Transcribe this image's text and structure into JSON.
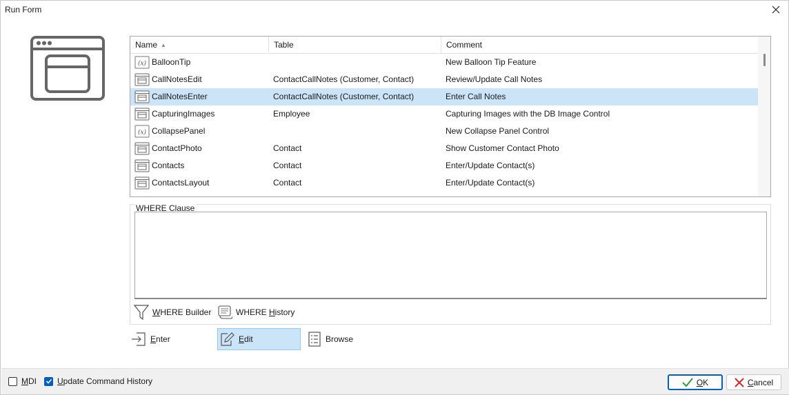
{
  "window": {
    "title": "Run Form"
  },
  "grid": {
    "columns": [
      {
        "label": "Name"
      },
      {
        "label": "Table"
      },
      {
        "label": "Comment"
      }
    ],
    "rows": [
      {
        "icon": "variable-icon",
        "name": "BalloonTip",
        "table": "",
        "comment": "New Balloon Tip Feature"
      },
      {
        "icon": "form-icon",
        "name": "CallNotesEdit",
        "table": "ContactCallNotes (Customer, Contact)",
        "comment": "Review/Update Call Notes"
      },
      {
        "icon": "form-icon",
        "name": "CallNotesEnter",
        "table": "ContactCallNotes (Customer, Contact)",
        "comment": "Enter Call Notes"
      },
      {
        "icon": "form-icon",
        "name": "CapturingImages",
        "table": "Employee",
        "comment": "Capturing Images with the DB Image Control"
      },
      {
        "icon": "variable-icon",
        "name": "CollapsePanel",
        "table": "",
        "comment": "New Collapse Panel Control"
      },
      {
        "icon": "form-icon",
        "name": "ContactPhoto",
        "table": "Contact",
        "comment": "Show Customer Contact Photo"
      },
      {
        "icon": "form-icon",
        "name": "Contacts",
        "table": "Contact",
        "comment": "Enter/Update Contact(s)"
      },
      {
        "icon": "form-icon",
        "name": "ContactsLayout",
        "table": "Contact",
        "comment": "Enter/Update Contact(s)"
      }
    ],
    "selected_row": 2
  },
  "where": {
    "legend": "WHERE Clause",
    "value": "",
    "builder_first": "W",
    "builder_rest": "HERE Builder",
    "history_pre": "WHERE ",
    "history_first": "H",
    "history_rest": "istory"
  },
  "actions": {
    "enter_first": "E",
    "enter_rest": "nter",
    "edit_first": "E",
    "edit_rest": "dit",
    "browse": "Browse",
    "active": "edit"
  },
  "footer": {
    "mdi_first": "M",
    "mdi_rest": "DI",
    "mdi_checked": false,
    "history_first": "U",
    "history_rest": "pdate Command History",
    "history_checked": true,
    "ok_first": "O",
    "ok_rest": "K",
    "cancel_first": "C",
    "cancel_rest": "ancel"
  },
  "colors": {
    "selection": "#cce4f7",
    "accent": "#005fb8",
    "ok_check": "#2e9b3a",
    "cancel_x": "#d42a2a"
  }
}
